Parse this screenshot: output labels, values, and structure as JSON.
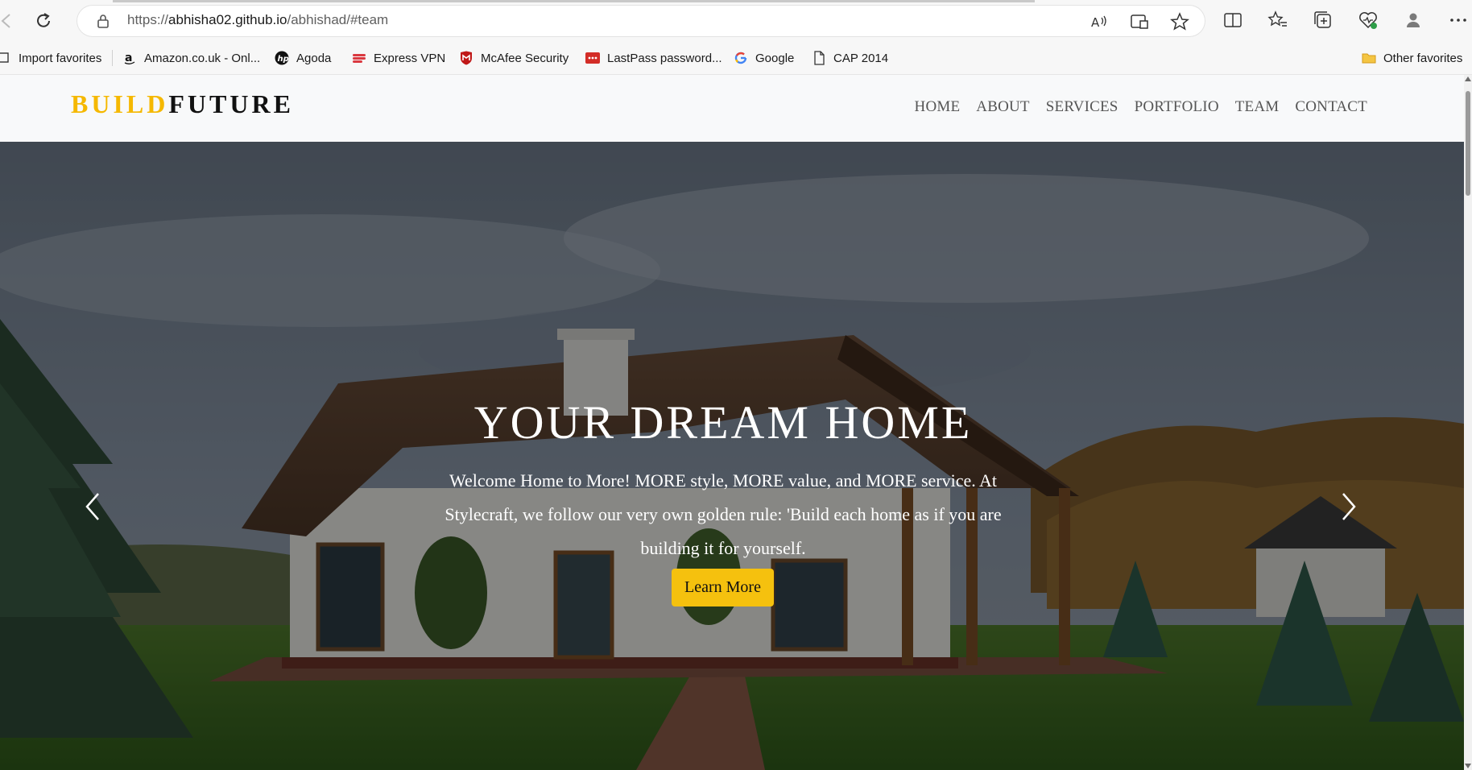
{
  "browser": {
    "url_prefix": "https://",
    "url_host": "abhisha02.github.io",
    "url_path": "/abhishad/#team",
    "bookmarks": [
      {
        "label": "Import favorites",
        "icon": "import-icon"
      },
      {
        "label": "Amazon.co.uk - Onl...",
        "icon": "amazon-icon"
      },
      {
        "label": "Agoda",
        "icon": "hp-icon"
      },
      {
        "label": "Express VPN",
        "icon": "expressvpn-icon"
      },
      {
        "label": "McAfee Security",
        "icon": "mcafee-icon"
      },
      {
        "label": "LastPass password...",
        "icon": "lastpass-icon"
      },
      {
        "label": "Google",
        "icon": "google-icon"
      },
      {
        "label": "CAP 2014",
        "icon": "document-icon"
      }
    ],
    "other_favorites": "Other favorites"
  },
  "site": {
    "logo_part1": "BUILD",
    "logo_part2": "FUTURE",
    "menu": [
      "HOME",
      "ABOUT",
      "SERVICES",
      "PORTFOLIO",
      "TEAM",
      "CONTACT"
    ]
  },
  "hero": {
    "title": "YOUR DREAM HOME",
    "text": "Welcome Home to More! MORE style, MORE value, and MORE service. At Stylecraft, we follow our very own golden rule: 'Build each home as if you are building it for yourself.",
    "button": "Learn More"
  },
  "colors": {
    "accent": "#f5c10e",
    "logo_gold": "#f5b800",
    "nav_bg": "#f8f9fa"
  }
}
